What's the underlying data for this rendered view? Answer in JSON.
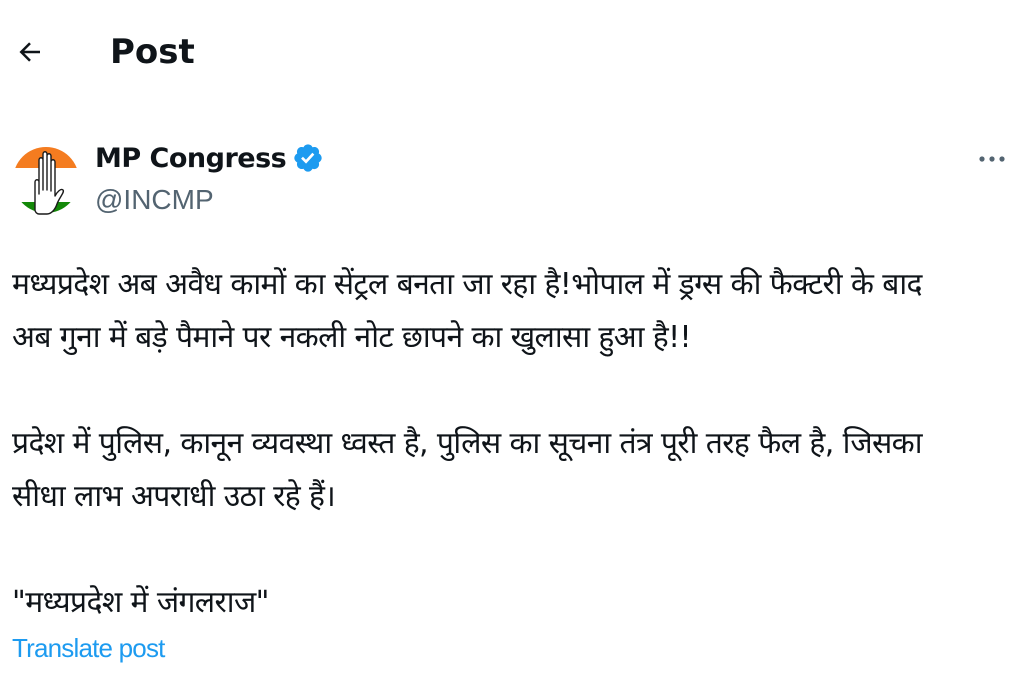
{
  "header": {
    "back_icon": "arrow-left-icon",
    "title": "Post"
  },
  "author": {
    "display_name": "MP Congress",
    "handle": "@INCMP",
    "verified_icon": "verified-badge-icon",
    "avatar_colors": {
      "top": "#f47c20",
      "middle": "#ffffff",
      "bottom": "#138808"
    }
  },
  "post": {
    "lines": [
      "मध्यप्रदेश अब अवैध कामों का सेंट्रल बनता जा रहा है!भोपाल में ड्रग्स की फैक्टरी के बाद",
      "अब गुना में बड़े पैमाने पर नकली नोट छापने का खुलासा हुआ है!!",
      "प्रदेश में पुलिस, कानून व्यवस्था ध्वस्त है, पुलिस का सूचना तंत्र पूरी तरह फैल है, जिसका",
      "सीधा लाभ अपराधी उठा रहे हैं।",
      "\"मध्यप्रदेश में जंगलराज\""
    ],
    "translate_label": "Translate post"
  },
  "colors": {
    "accent": "#1d9bf0",
    "text": "#0f1419",
    "secondary_text": "#536471"
  }
}
